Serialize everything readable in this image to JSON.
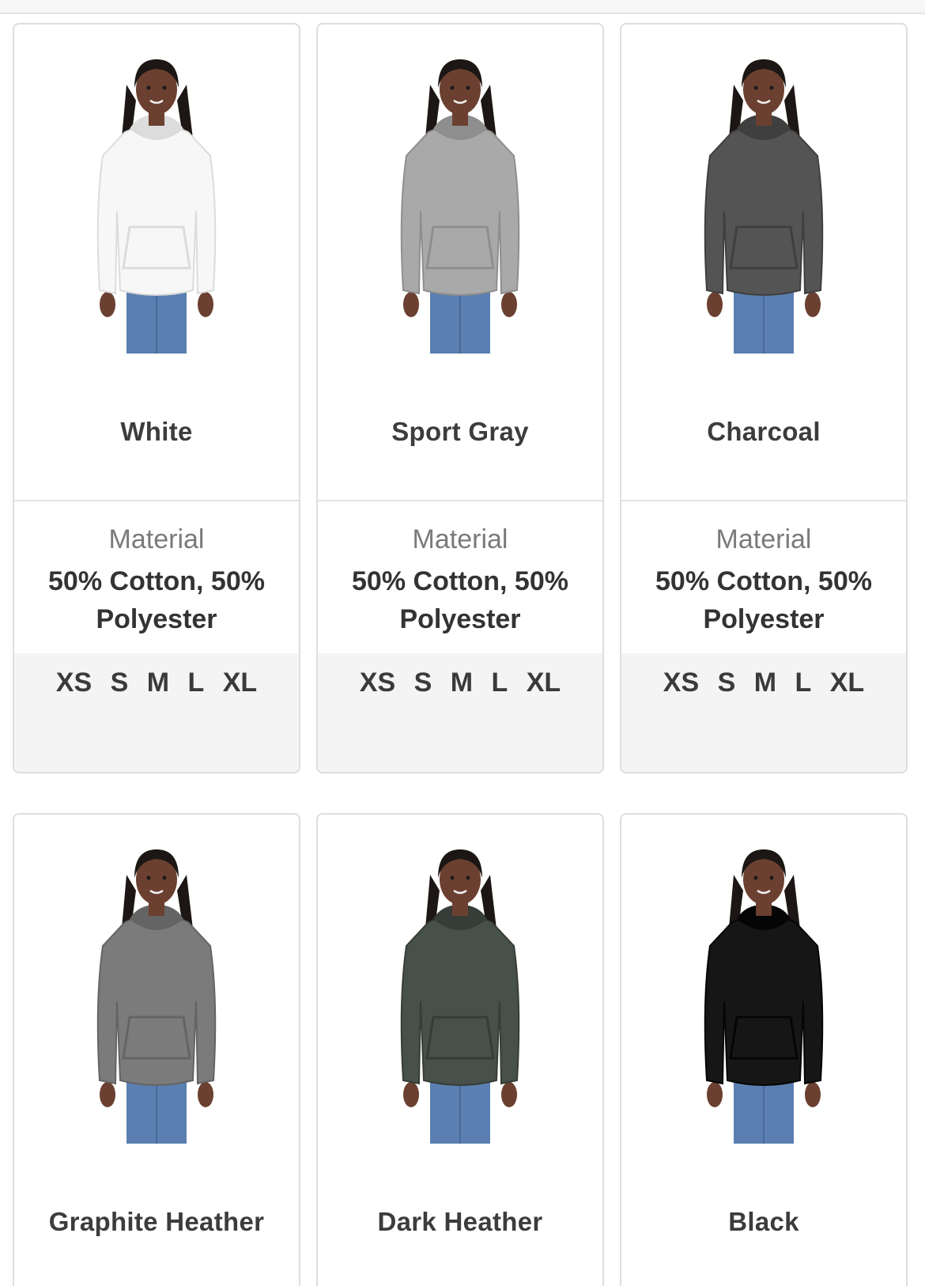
{
  "products": [
    {
      "color_name": "White",
      "material_label": "Material",
      "material_value": "50% Cotton, 50% Polyester",
      "sizes": [
        "XS",
        "S",
        "M",
        "L",
        "XL"
      ],
      "hoodie_color": "#f7f7f7",
      "shade_color": "#dcdcdc"
    },
    {
      "color_name": "Sport Gray",
      "material_label": "Material",
      "material_value": "50% Cotton, 50% Polyester",
      "sizes": [
        "XS",
        "S",
        "M",
        "L",
        "XL"
      ],
      "hoodie_color": "#a9a9a9",
      "shade_color": "#8e8e8e"
    },
    {
      "color_name": "Charcoal",
      "material_label": "Material",
      "material_value": "50% Cotton, 50% Polyester",
      "sizes": [
        "XS",
        "S",
        "M",
        "L",
        "XL"
      ],
      "hoodie_color": "#545454",
      "shade_color": "#3f3f3f"
    },
    {
      "color_name": "Graphite Heather",
      "hoodie_color": "#7b7b7b",
      "shade_color": "#646464"
    },
    {
      "color_name": "Dark Heather",
      "hoodie_color": "#475049",
      "shade_color": "#363d38"
    },
    {
      "color_name": "Black",
      "hoodie_color": "#161616",
      "shade_color": "#050505"
    }
  ],
  "colors": {
    "card_border": "#dedede",
    "sizes_band": "#f4f4f4",
    "jeans": "#5a7fb0",
    "skin": "#6b4030",
    "hair": "#1c1714"
  }
}
